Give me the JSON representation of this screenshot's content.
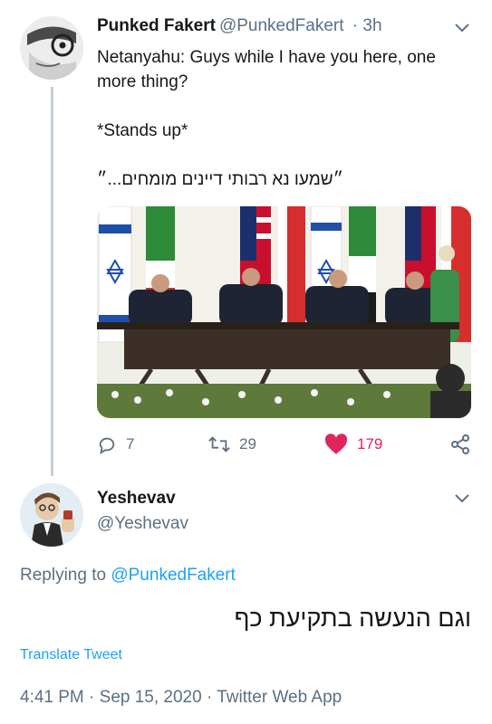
{
  "tweet": {
    "author_name": "Punked Fakert",
    "author_handle": "@PunkedFakert",
    "time": "· 3h",
    "line1": "Netanyahu: Guys while I have you here, one more thing?",
    "line2": "*Stands up*",
    "line3": "״שמעו נא רבותי דיינים מומחים...״",
    "replies": "7",
    "retweets": "29",
    "likes": "179"
  },
  "reply": {
    "author_name": "Yeshevav",
    "author_handle": "@Yeshevav",
    "replying_prefix": "Replying to",
    "replying_mention": "@PunkedFakert",
    "text": "וגם הנעשה בתקיעת כף",
    "translate_label": "Translate Tweet",
    "meta": "4:41 PM · Sep 15, 2020 · Twitter Web App"
  },
  "icons": [
    "chevron-down-icon",
    "reply-icon",
    "retweet-icon",
    "heart-icon",
    "share-icon"
  ],
  "colors": {
    "link": "#1da1f2",
    "secondary_text": "#5b7083",
    "like": "#e0245e",
    "thread_line": "#c4cfd6"
  }
}
